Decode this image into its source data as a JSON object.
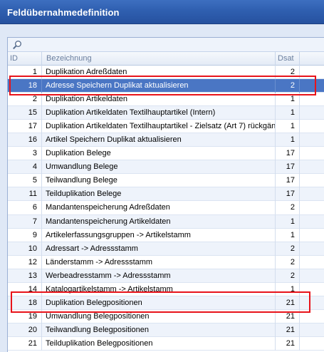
{
  "window": {
    "title": "Feldübernahmedefinition"
  },
  "grid": {
    "columns": {
      "id": "ID",
      "bezeichnung": "Bezeichnung",
      "dsat": "Dsat"
    },
    "rows": [
      {
        "id": "1",
        "bezeichnung": "Duplikation Adreßdaten",
        "dsat": "2"
      },
      {
        "id": "18",
        "bezeichnung": "Adresse Speichern Duplikat aktualisieren",
        "dsat": "2",
        "selected": true
      },
      {
        "id": "2",
        "bezeichnung": "Duplikation Artikeldaten",
        "dsat": "1"
      },
      {
        "id": "15",
        "bezeichnung": "Duplikation Artikeldaten Textilhauptartikel (Intern)",
        "dsat": "1"
      },
      {
        "id": "17",
        "bezeichnung": "Duplikation Artikeldaten Textilhauptartikel - Zielsatz (Art 7) rückgän",
        "dsat": "1"
      },
      {
        "id": "16",
        "bezeichnung": "Artikel Speichern Duplikat aktualisieren",
        "dsat": "1"
      },
      {
        "id": "3",
        "bezeichnung": "Duplikation Belege",
        "dsat": "17"
      },
      {
        "id": "4",
        "bezeichnung": "Umwandlung Belege",
        "dsat": "17"
      },
      {
        "id": "5",
        "bezeichnung": "Teilwandlung Belege",
        "dsat": "17"
      },
      {
        "id": "11",
        "bezeichnung": "Teilduplikation Belege",
        "dsat": "17"
      },
      {
        "id": "6",
        "bezeichnung": "Mandantenspeicherung Adreßdaten",
        "dsat": "2"
      },
      {
        "id": "7",
        "bezeichnung": "Mandantenspeicherung Artikeldaten",
        "dsat": "1"
      },
      {
        "id": "9",
        "bezeichnung": "Artikelerfassungsgruppen -> Artikelstamm",
        "dsat": "1"
      },
      {
        "id": "10",
        "bezeichnung": "Adressart -> Adressstamm",
        "dsat": "2"
      },
      {
        "id": "12",
        "bezeichnung": "Länderstamm -> Adressstamm",
        "dsat": "2"
      },
      {
        "id": "13",
        "bezeichnung": "Werbeadresstamm -> Adressstamm",
        "dsat": "2"
      },
      {
        "id": "14",
        "bezeichnung": "Katalogartikelstamm -> Artikelstamm",
        "dsat": "1"
      },
      {
        "id": "18",
        "bezeichnung": "Duplikation Belegpositionen",
        "dsat": "21"
      },
      {
        "id": "19",
        "bezeichnung": "Umwandlung Belegpositionen",
        "dsat": "21"
      },
      {
        "id": "20",
        "bezeichnung": "Teilwandlung Belegpositionen",
        "dsat": "21"
      },
      {
        "id": "21",
        "bezeichnung": "Teilduplikation Belegpositionen",
        "dsat": "21"
      }
    ]
  },
  "icons": {
    "search": "magnifier-icon"
  },
  "colors": {
    "title_bar": "#2f5fb0",
    "selected_row": "#4a76c4",
    "highlight_box": "#e8131a"
  }
}
